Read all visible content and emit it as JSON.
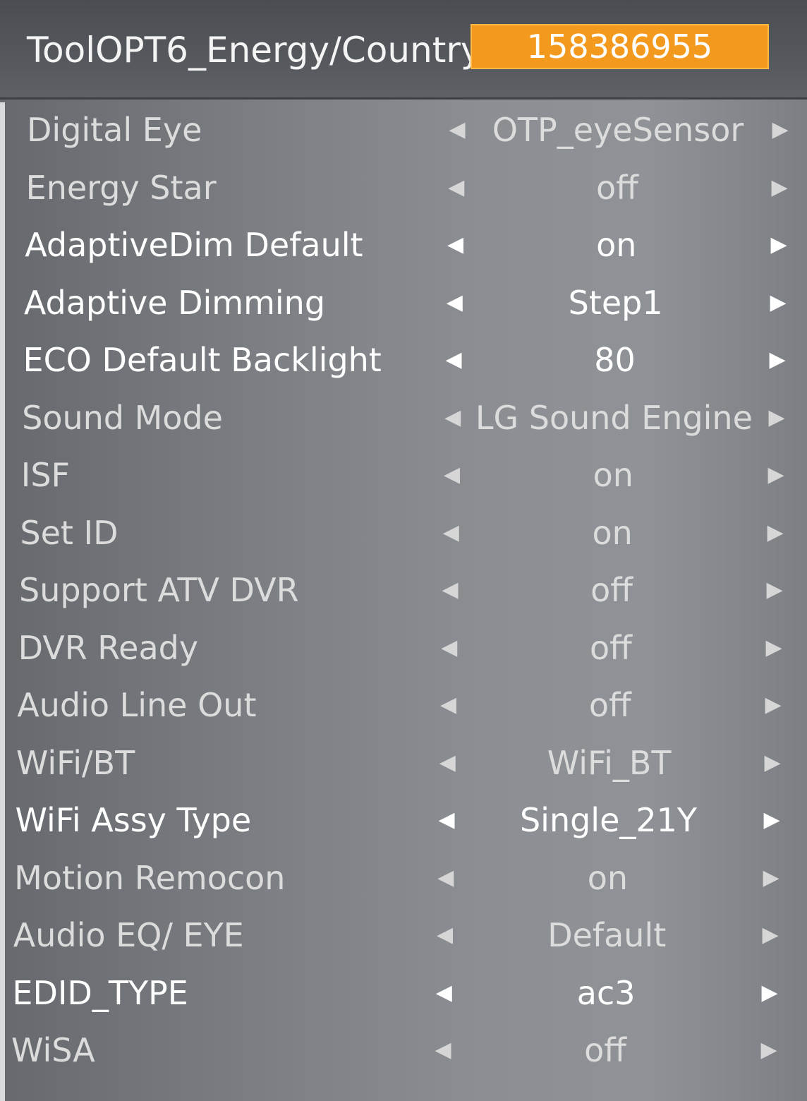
{
  "header": {
    "title": "ToolOPT6_Energy/Country",
    "code": "158386955"
  },
  "icons": {
    "left": "arrow-left-icon",
    "right": "arrow-right-icon"
  },
  "colors": {
    "code_box": "#f39a1e",
    "active_text": "#ffffff",
    "inactive_text": "#dcdcdc"
  },
  "rows": [
    {
      "label": "Digital Eye",
      "value": "OTP_eyeSensor",
      "active": false
    },
    {
      "label": "Energy Star",
      "value": "off",
      "active": false
    },
    {
      "label": "AdaptiveDim Default",
      "value": "on",
      "active": true
    },
    {
      "label": "Adaptive Dimming",
      "value": "Step1",
      "active": true
    },
    {
      "label": "ECO Default Backlight",
      "value": "80",
      "active": true
    },
    {
      "label": "Sound Mode",
      "value": "LG Sound Engine",
      "active": false
    },
    {
      "label": "ISF",
      "value": "on",
      "active": false
    },
    {
      "label": "Set ID",
      "value": "on",
      "active": false
    },
    {
      "label": "Support ATV DVR",
      "value": "off",
      "active": false
    },
    {
      "label": "DVR Ready",
      "value": "off",
      "active": false
    },
    {
      "label": "Audio Line Out",
      "value": "off",
      "active": false
    },
    {
      "label": "WiFi/BT",
      "value": "WiFi_BT",
      "active": false
    },
    {
      "label": "WiFi Assy Type",
      "value": "Single_21Y",
      "active": true
    },
    {
      "label": "Motion Remocon",
      "value": "on",
      "active": false
    },
    {
      "label": "Audio EQ/ EYE",
      "value": "Default",
      "active": false
    },
    {
      "label": "EDID_TYPE",
      "value": "ac3",
      "active": true
    },
    {
      "label": "WiSA",
      "value": "off",
      "active": false
    }
  ]
}
